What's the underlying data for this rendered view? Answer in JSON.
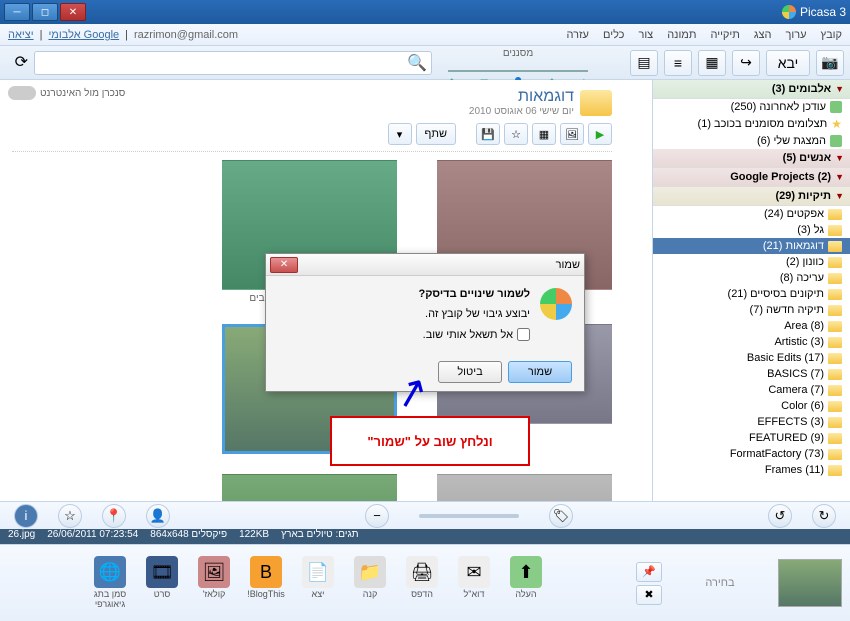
{
  "titlebar": {
    "app": "Picasa 3"
  },
  "menubar": {
    "items": [
      "קובץ",
      "ערוך",
      "הצג",
      "תיקייה",
      "תמונה",
      "צור",
      "כלים",
      "עזרה"
    ],
    "user_email": "razrimon@gmail.com",
    "albums_link": "אלבומי Google",
    "exit": "יציאה"
  },
  "toolbar": {
    "import": "יבא",
    "filters_label": "מסננים",
    "search_placeholder": ""
  },
  "sidebar": {
    "sections": [
      {
        "label": "אלבומים (3)",
        "cls": "green"
      },
      {
        "label": "אנשים (5)",
        "cls": ""
      },
      {
        "label": "Google Projects (2)",
        "cls": ""
      },
      {
        "label": "תיקיות (29)",
        "cls": "yellow"
      }
    ],
    "albums": [
      "עודכן לאחרונה (250)",
      "תצלומים מסומנים בכוכב (1)",
      "המצגת שלי (6)"
    ],
    "folders": [
      "אפקטים (24)",
      "גל (3)",
      "דוגמאות (21)",
      "כוונון (2)",
      "עריכה (8)",
      "תיקונים בסיסיים (21)",
      "תיקיה חדשה (7)",
      "(8) Area",
      "(3) Artistic",
      "(17) Basic Edits",
      "(7) BASICS",
      "(7) Camera",
      "(6) Color",
      "(3) EFFECTS",
      "(9) FEATURED",
      "(73) FormatFactory",
      "(11) Frames"
    ]
  },
  "content": {
    "sync_label": "סנכרן מול האינטרנט",
    "album_title": "דוגמאות",
    "album_date": "יום שישי 06 אוגוסט 2010",
    "share_btn": "שתף",
    "caption1": "טל וקארין החברים הכי טובים"
  },
  "statusbar": {
    "filename": "26.jpg",
    "datetime": "26/06/2011 07:23:54",
    "dims": "864x648 פיקסלים",
    "size": "122KB",
    "tags": "תגים: טיולים בארץ"
  },
  "bottom": {
    "tray_label": "בחירה",
    "tools": [
      {
        "label": "סמן בתג\nגיאוגרפי",
        "icon": "🌐",
        "bg": "#4a7ab0"
      },
      {
        "label": "סרט",
        "icon": "🎞",
        "bg": "#3a5a8a"
      },
      {
        "label": "קולאז'",
        "icon": "🖼",
        "bg": "#c88"
      },
      {
        "label": "BlogThis!",
        "icon": "B",
        "bg": "#f5a030"
      },
      {
        "label": "יצא",
        "icon": "📄",
        "bg": "#eee"
      },
      {
        "label": "קנה",
        "icon": "📁",
        "bg": "#ddd"
      },
      {
        "label": "הדפס",
        "icon": "🖨",
        "bg": "#eee"
      },
      {
        "label": "דוא\"ל",
        "icon": "✉",
        "bg": "#eee"
      },
      {
        "label": "העלה",
        "icon": "⬆",
        "bg": "#8c8"
      }
    ]
  },
  "dialog": {
    "title": "שמור",
    "question": "לשמור שינויים בדיסק?",
    "info": "יבוצע גיבוי של קובץ זה.",
    "checkbox": "אל תשאל אותי שוב.",
    "save": "שמור",
    "cancel": "ביטול"
  },
  "callout": {
    "text": "ונלחץ שוב על \"שמור\""
  }
}
